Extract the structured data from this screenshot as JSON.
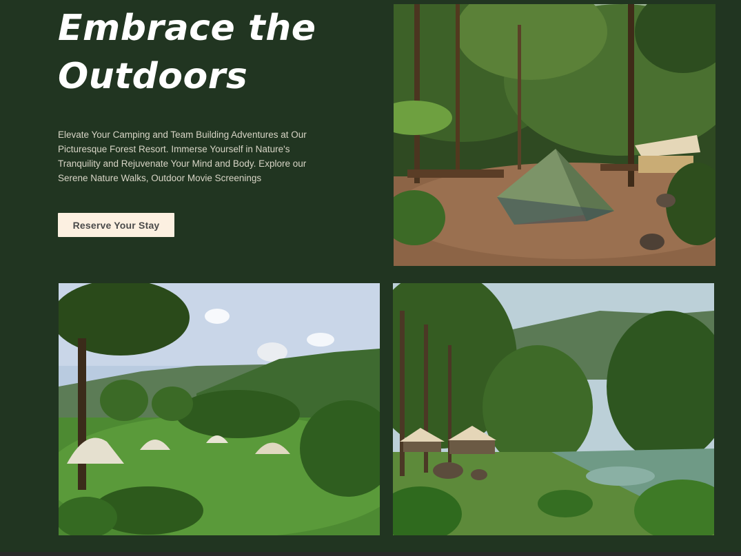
{
  "hero": {
    "title": "Embrace the Outdoors",
    "description": "Elevate Your Camping and Team Building Adventures at Our Picturesque Forest Resort. Immerse Yourself in Nature's Tranquility and Rejuvenate Your Mind and Body. Explore our Serene Nature Walks, Outdoor Movie Screenings",
    "cta_label": "Reserve Your Stay"
  },
  "gallery": {
    "photos": [
      {
        "subject": "forest-campsite-tent"
      },
      {
        "subject": "meadow-tents-hills"
      },
      {
        "subject": "riverside-canopies"
      }
    ]
  },
  "colors": {
    "background": "#213521",
    "button_bg": "#fcf0e1",
    "title_text": "#ffffff",
    "body_text": "#d8d5c6"
  }
}
